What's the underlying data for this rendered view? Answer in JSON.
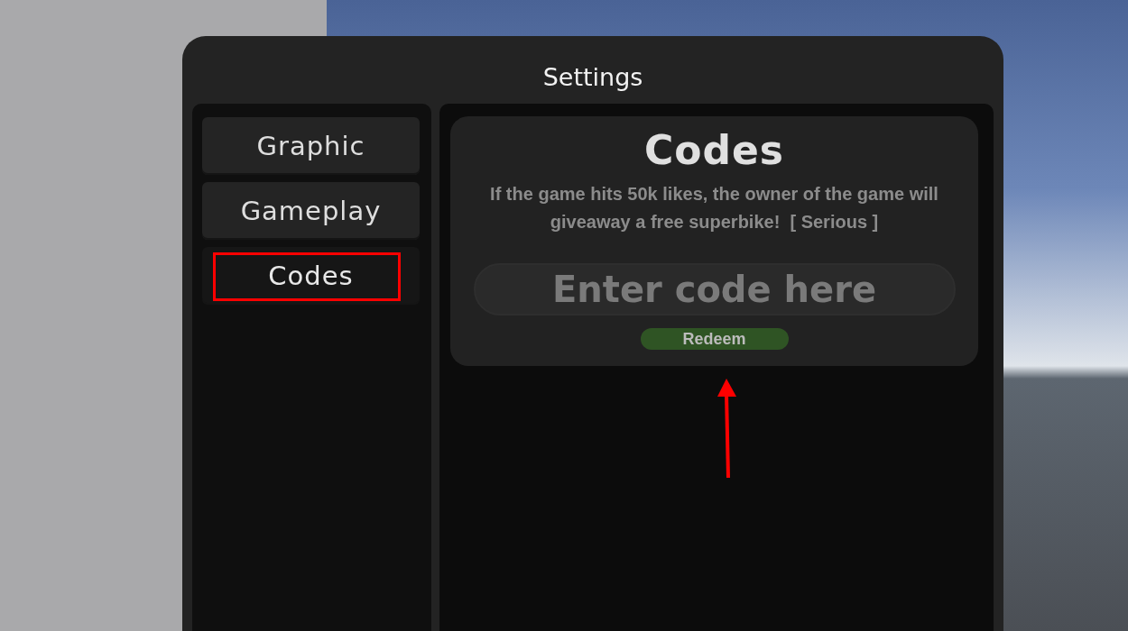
{
  "window": {
    "title": "Settings"
  },
  "tabs": [
    {
      "label": "Graphic",
      "selected": false,
      "highlighted": false
    },
    {
      "label": "Gameplay",
      "selected": false,
      "highlighted": false
    },
    {
      "label": "Codes",
      "selected": true,
      "highlighted": true
    }
  ],
  "codes_card": {
    "heading": "Codes",
    "message": "If the game hits 50k likes, the owner of the game will giveaway a free superbike!  [ Serious ]",
    "code_field": {
      "placeholder": "Enter code here"
    },
    "redeem_button": "Redeem"
  },
  "annotation": {
    "kind": "arrow"
  }
}
